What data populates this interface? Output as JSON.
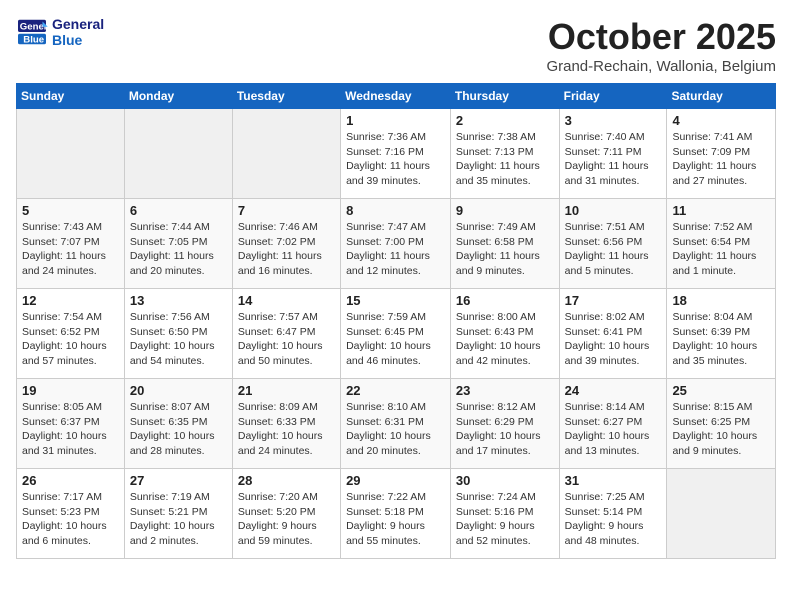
{
  "header": {
    "logo_line1": "General",
    "logo_line2": "Blue",
    "month": "October 2025",
    "location": "Grand-Rechain, Wallonia, Belgium"
  },
  "weekdays": [
    "Sunday",
    "Monday",
    "Tuesday",
    "Wednesday",
    "Thursday",
    "Friday",
    "Saturday"
  ],
  "weeks": [
    [
      {
        "day": "",
        "info": ""
      },
      {
        "day": "",
        "info": ""
      },
      {
        "day": "",
        "info": ""
      },
      {
        "day": "1",
        "info": "Sunrise: 7:36 AM\nSunset: 7:16 PM\nDaylight: 11 hours\nand 39 minutes."
      },
      {
        "day": "2",
        "info": "Sunrise: 7:38 AM\nSunset: 7:13 PM\nDaylight: 11 hours\nand 35 minutes."
      },
      {
        "day": "3",
        "info": "Sunrise: 7:40 AM\nSunset: 7:11 PM\nDaylight: 11 hours\nand 31 minutes."
      },
      {
        "day": "4",
        "info": "Sunrise: 7:41 AM\nSunset: 7:09 PM\nDaylight: 11 hours\nand 27 minutes."
      }
    ],
    [
      {
        "day": "5",
        "info": "Sunrise: 7:43 AM\nSunset: 7:07 PM\nDaylight: 11 hours\nand 24 minutes."
      },
      {
        "day": "6",
        "info": "Sunrise: 7:44 AM\nSunset: 7:05 PM\nDaylight: 11 hours\nand 20 minutes."
      },
      {
        "day": "7",
        "info": "Sunrise: 7:46 AM\nSunset: 7:02 PM\nDaylight: 11 hours\nand 16 minutes."
      },
      {
        "day": "8",
        "info": "Sunrise: 7:47 AM\nSunset: 7:00 PM\nDaylight: 11 hours\nand 12 minutes."
      },
      {
        "day": "9",
        "info": "Sunrise: 7:49 AM\nSunset: 6:58 PM\nDaylight: 11 hours\nand 9 minutes."
      },
      {
        "day": "10",
        "info": "Sunrise: 7:51 AM\nSunset: 6:56 PM\nDaylight: 11 hours\nand 5 minutes."
      },
      {
        "day": "11",
        "info": "Sunrise: 7:52 AM\nSunset: 6:54 PM\nDaylight: 11 hours\nand 1 minute."
      }
    ],
    [
      {
        "day": "12",
        "info": "Sunrise: 7:54 AM\nSunset: 6:52 PM\nDaylight: 10 hours\nand 57 minutes."
      },
      {
        "day": "13",
        "info": "Sunrise: 7:56 AM\nSunset: 6:50 PM\nDaylight: 10 hours\nand 54 minutes."
      },
      {
        "day": "14",
        "info": "Sunrise: 7:57 AM\nSunset: 6:47 PM\nDaylight: 10 hours\nand 50 minutes."
      },
      {
        "day": "15",
        "info": "Sunrise: 7:59 AM\nSunset: 6:45 PM\nDaylight: 10 hours\nand 46 minutes."
      },
      {
        "day": "16",
        "info": "Sunrise: 8:00 AM\nSunset: 6:43 PM\nDaylight: 10 hours\nand 42 minutes."
      },
      {
        "day": "17",
        "info": "Sunrise: 8:02 AM\nSunset: 6:41 PM\nDaylight: 10 hours\nand 39 minutes."
      },
      {
        "day": "18",
        "info": "Sunrise: 8:04 AM\nSunset: 6:39 PM\nDaylight: 10 hours\nand 35 minutes."
      }
    ],
    [
      {
        "day": "19",
        "info": "Sunrise: 8:05 AM\nSunset: 6:37 PM\nDaylight: 10 hours\nand 31 minutes."
      },
      {
        "day": "20",
        "info": "Sunrise: 8:07 AM\nSunset: 6:35 PM\nDaylight: 10 hours\nand 28 minutes."
      },
      {
        "day": "21",
        "info": "Sunrise: 8:09 AM\nSunset: 6:33 PM\nDaylight: 10 hours\nand 24 minutes."
      },
      {
        "day": "22",
        "info": "Sunrise: 8:10 AM\nSunset: 6:31 PM\nDaylight: 10 hours\nand 20 minutes."
      },
      {
        "day": "23",
        "info": "Sunrise: 8:12 AM\nSunset: 6:29 PM\nDaylight: 10 hours\nand 17 minutes."
      },
      {
        "day": "24",
        "info": "Sunrise: 8:14 AM\nSunset: 6:27 PM\nDaylight: 10 hours\nand 13 minutes."
      },
      {
        "day": "25",
        "info": "Sunrise: 8:15 AM\nSunset: 6:25 PM\nDaylight: 10 hours\nand 9 minutes."
      }
    ],
    [
      {
        "day": "26",
        "info": "Sunrise: 7:17 AM\nSunset: 5:23 PM\nDaylight: 10 hours\nand 6 minutes."
      },
      {
        "day": "27",
        "info": "Sunrise: 7:19 AM\nSunset: 5:21 PM\nDaylight: 10 hours\nand 2 minutes."
      },
      {
        "day": "28",
        "info": "Sunrise: 7:20 AM\nSunset: 5:20 PM\nDaylight: 9 hours\nand 59 minutes."
      },
      {
        "day": "29",
        "info": "Sunrise: 7:22 AM\nSunset: 5:18 PM\nDaylight: 9 hours\nand 55 minutes."
      },
      {
        "day": "30",
        "info": "Sunrise: 7:24 AM\nSunset: 5:16 PM\nDaylight: 9 hours\nand 52 minutes."
      },
      {
        "day": "31",
        "info": "Sunrise: 7:25 AM\nSunset: 5:14 PM\nDaylight: 9 hours\nand 48 minutes."
      },
      {
        "day": "",
        "info": ""
      }
    ]
  ]
}
